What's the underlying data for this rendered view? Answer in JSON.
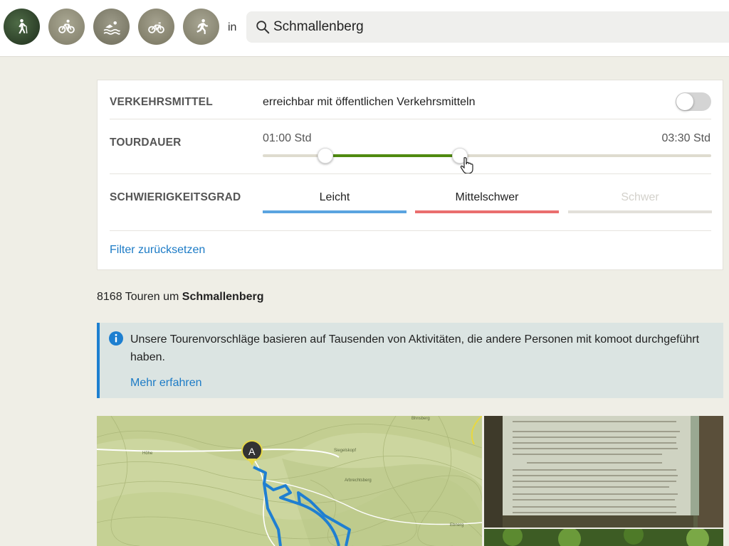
{
  "sports": [
    {
      "name": "hiking-icon",
      "label": "Wandern",
      "selected": true
    },
    {
      "name": "mountain-bike-icon",
      "label": "Mountainbike",
      "selected": false
    },
    {
      "name": "swimming-icon",
      "label": "Schwimmen",
      "selected": false
    },
    {
      "name": "road-bike-icon",
      "label": "Rennrad",
      "selected": false
    },
    {
      "name": "running-icon",
      "label": "Laufen",
      "selected": false
    }
  ],
  "search": {
    "in_label": "in",
    "value": "Schmallenberg",
    "icon": "search-icon"
  },
  "filters": {
    "transport": {
      "label": "VERKEHRSMITTEL",
      "option_text": "erreichbar mit öffentlichen Verkehrsmitteln",
      "enabled": false
    },
    "duration": {
      "label": "TOURDAUER",
      "min_label": "01:00 Std",
      "max_label": "03:30 Std",
      "low_fraction": 0.14,
      "high_fraction": 0.44
    },
    "difficulty": {
      "label": "SCHWIERIGKEITSGRAD",
      "options": [
        {
          "label": "Leicht",
          "color": "#5aa4e0",
          "active": true
        },
        {
          "label": "Mittelschwer",
          "color": "#ea6e6e",
          "active": true
        },
        {
          "label": "Schwer",
          "color": "#e2e0da",
          "active": false
        }
      ]
    },
    "reset_label": "Filter zurücksetzen"
  },
  "results": {
    "count": "8168",
    "prefix": "Touren um",
    "place": "Schmallenberg"
  },
  "info": {
    "icon": "info-icon",
    "text": "Unsere Tourenvorschläge basieren auf Tausenden von Aktivitäten, die andere Personen mit komoot durchgeführt haben.",
    "link": "Mehr erfahren"
  },
  "map": {
    "marker": "A",
    "places": [
      "Höhe",
      "Siegelskopf",
      "Arbrechtsberg",
      "Ebnerg",
      "Bhnsberg"
    ]
  },
  "colors": {
    "accent_blue": "#1c7bc6",
    "slider_green": "#4f8a10",
    "route_blue": "#1f7fd1"
  }
}
